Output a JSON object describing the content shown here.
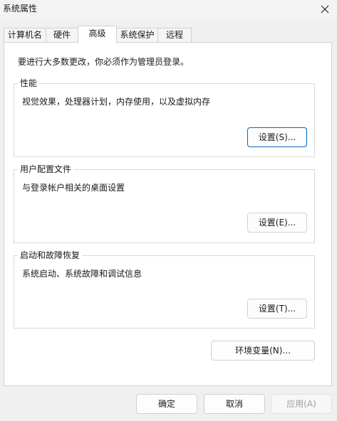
{
  "window": {
    "title": "系统属性"
  },
  "tabs": [
    {
      "label": "计算机名",
      "active": false
    },
    {
      "label": "硬件",
      "active": false
    },
    {
      "label": "高级",
      "active": true
    },
    {
      "label": "系统保护",
      "active": false
    },
    {
      "label": "远程",
      "active": false
    }
  ],
  "advanced": {
    "notice": "要进行大多数更改，你必须作为管理员登录。",
    "performance": {
      "title": "性能",
      "description": "视觉效果，处理器计划，内存使用，以及虚拟内存",
      "settings_button": "设置(S)..."
    },
    "user_profiles": {
      "title": "用户配置文件",
      "description": "与登录帐户相关的桌面设置",
      "settings_button": "设置(E)..."
    },
    "startup_recovery": {
      "title": "启动和故障恢复",
      "description": "系统启动、系统故障和调试信息",
      "settings_button": "设置(T)..."
    },
    "env_vars_button": "环境变量(N)..."
  },
  "footer": {
    "ok": "确定",
    "cancel": "取消",
    "apply": "应用(A)"
  },
  "icons": {
    "close": "close-icon"
  },
  "colors": {
    "default_button_border": "#0067c0",
    "disabled_text": "#a0a0a0"
  }
}
